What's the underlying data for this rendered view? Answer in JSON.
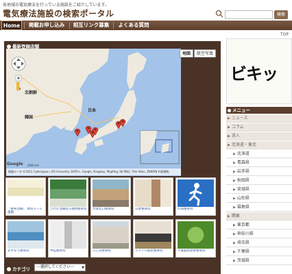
{
  "header": {
    "tagline": "各地域の電気療法を行っている施設をご紹介しています。",
    "title": "電気療法施設の検索ポータル",
    "search_placeholder": "",
    "search_button": "検索"
  },
  "nav": {
    "items": [
      {
        "label": "Home",
        "active": true
      },
      {
        "label": "掲載お申し込み",
        "active": false
      },
      {
        "label": "相互リンク募集",
        "active": false
      },
      {
        "label": "よくある質問",
        "active": false
      }
    ],
    "top_link": "TOP"
  },
  "main": {
    "section_title": "最新登録店舗",
    "map": {
      "btn_map": "地図",
      "btn_satellite": "航空写真",
      "label_north_korea": "北朝鮮",
      "label_korea": "韓国",
      "label_japan": "日本",
      "scale": "200 km",
      "footer": "地図データ ©2013 Cyberjapan, GIS Innovatia, DATA+, Google, Kingway, Mapfing, SK M&C, Tele Atlas, ZENRIN 利用規約",
      "google": "Google"
    },
    "facilities": [
      {
        "name": "「整骨治療」 専科メール連鎖"
      },
      {
        "name": "さわだ治療院×南野整骨院"
      },
      {
        "name": "大阪北口接骨院"
      },
      {
        "name": "山本整骨院"
      },
      {
        "name": "円満整骨院"
      },
      {
        "name": "あすなろ整骨院"
      },
      {
        "name": "中田整骨院"
      },
      {
        "name": "ふじみ整骨院"
      },
      {
        "name": "スマイル鍼灸整骨院"
      },
      {
        "name": "千葉鍼灸接骨整骨院"
      }
    ],
    "category_label": "カテゴリ",
    "category_select": "---選択してください---"
  },
  "sidebar": {
    "banner_text": "ビキッ",
    "menu_title": "メニュー",
    "items": [
      {
        "label": "ニュース",
        "sub": false
      },
      {
        "label": "コラム",
        "sub": false
      },
      {
        "label": "求人",
        "sub": false
      },
      {
        "label": "北海道・東北",
        "sub": false
      },
      {
        "label": "北海道",
        "sub": true
      },
      {
        "label": "青森県",
        "sub": true
      },
      {
        "label": "岩手県",
        "sub": true
      },
      {
        "label": "秋田県",
        "sub": true
      },
      {
        "label": "宮城県",
        "sub": true
      },
      {
        "label": "山形県",
        "sub": true
      },
      {
        "label": "福島県",
        "sub": true
      },
      {
        "label": "関東",
        "sub": false
      },
      {
        "label": "東京都",
        "sub": true
      },
      {
        "label": "神奈川県",
        "sub": true
      },
      {
        "label": "埼玉県",
        "sub": true
      },
      {
        "label": "千葉県",
        "sub": true
      },
      {
        "label": "茨城県",
        "sub": true
      }
    ]
  }
}
